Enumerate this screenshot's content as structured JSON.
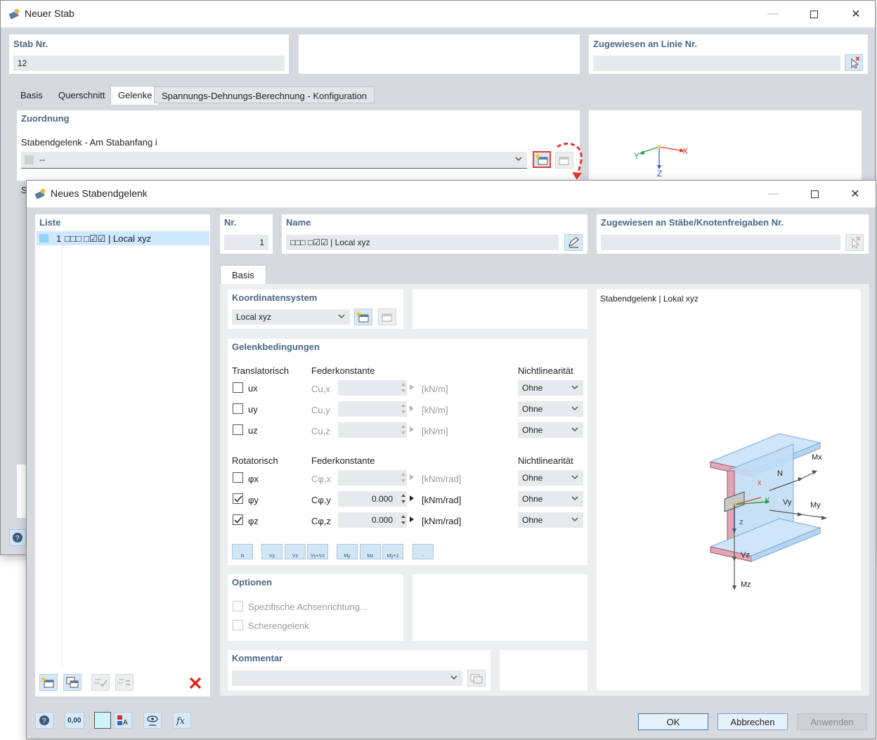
{
  "main_window": {
    "title": "Neuer Stab",
    "stab_nr_label": "Stab Nr.",
    "stab_nr_value": "12",
    "assigned_line_label": "Zugewiesen an Linie Nr.",
    "tabs": [
      {
        "label": "Basis"
      },
      {
        "label": "Querschnitt"
      },
      {
        "label": "Gelenke"
      },
      {
        "label": "Spannungs-Dehnungs-Berechnung - Konfiguration"
      }
    ],
    "active_tab": "Gelenke",
    "assignment_title": "Zuordnung",
    "hinge_start_label": "Stabendgelenk - Am Stabanfang i",
    "hinge_start_value": "--",
    "hinge_end_label_fragment": "St",
    "axes": {
      "x": "X",
      "y": "Y",
      "z": "Z"
    }
  },
  "dialog": {
    "title": "Neues Stabendgelenk",
    "list_title": "Liste",
    "list_items": [
      {
        "number": "1",
        "text": "□□□ □☑☑ | Local xyz"
      }
    ],
    "nr_label": "Nr.",
    "nr_value": "1",
    "name_label": "Name",
    "name_value": "□□□ □☑☑ | Local xyz",
    "assigned_label": "Zugewiesen an Stäbe/Knotenfreigaben Nr.",
    "tab_basis": "Basis",
    "coord_title": "Koordinatensystem",
    "coord_value": "Local xyz",
    "conditions_title": "Gelenkbedingungen",
    "translational_label": "Translatorisch",
    "rotational_label": "Rotatorisch",
    "spring_label": "Federkonstante",
    "nonlinearity_label": "Nichtlinearität",
    "translational_rows": [
      {
        "dof": "ux",
        "spring": "Cu,x",
        "value": "",
        "unit": "[kN/m]",
        "nonlinearity": "Ohne",
        "checked": false
      },
      {
        "dof": "uy",
        "spring": "Cu,y",
        "value": "",
        "unit": "[kN/m]",
        "nonlinearity": "Ohne",
        "checked": false
      },
      {
        "dof": "uz",
        "spring": "Cu,z",
        "value": "",
        "unit": "[kN/m]",
        "nonlinearity": "Ohne",
        "checked": false
      }
    ],
    "rotational_rows": [
      {
        "dof": "φx",
        "spring": "Cφ,x",
        "value": "",
        "unit": "[kNm/rad]",
        "nonlinearity": "Ohne",
        "checked": false
      },
      {
        "dof": "φy",
        "spring": "Cφ,y",
        "value": "0.000",
        "unit": "[kNm/rad]",
        "nonlinearity": "Ohne",
        "checked": true
      },
      {
        "dof": "φz",
        "spring": "Cφ,z",
        "value": "0.000",
        "unit": "[kNm/rad]",
        "nonlinearity": "Ohne",
        "checked": true
      }
    ],
    "hinge_buttons": [
      "N",
      "Vy",
      "Vz",
      "Vy+Vz",
      "My",
      "Mz",
      "My+z",
      "-"
    ],
    "options_title": "Optionen",
    "option_axis_direction": "Spezifische Achsenrichtung...",
    "option_shear_hinge": "Scherengelenk",
    "comment_title": "Kommentar",
    "preview_title": "Stabendgelenk | Lokal xyz",
    "preview_labels": {
      "N": "N",
      "Mx": "Mx",
      "Vy": "Vy",
      "My": "My",
      "Vz": "Vz",
      "Mz": "Mz",
      "x": "x",
      "y": "y",
      "z": "z"
    },
    "footer_value_readout": "0,00",
    "ok_label": "OK",
    "cancel_label": "Abbrechen",
    "apply_label": "Anwenden"
  },
  "colors": {
    "accent": "#4a6785",
    "highlight": "#e53935",
    "selection": "#cde8ff",
    "button_blue": "#d3e6f4"
  }
}
